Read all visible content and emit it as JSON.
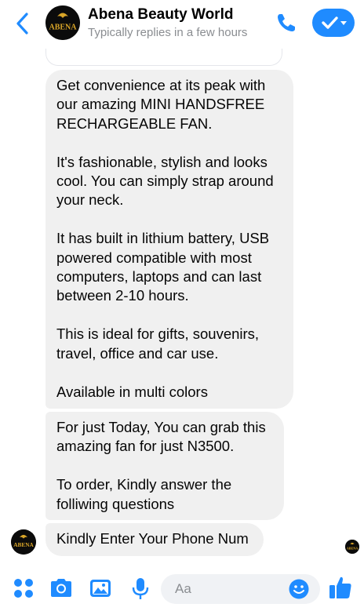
{
  "header": {
    "title": "Abena Beauty World",
    "subtitle": "Typically replies in a few hours",
    "avatar_text": "ABENA"
  },
  "messages": [
    {
      "sender": "page",
      "text": "Get convenience at its peak with\nour amazing MINI HANDSFREE\nRECHARGEABLE FAN.\n\nIt's fashionable, stylish and looks\ncool. You can simply strap around\nyour neck.\n\nIt has built in lithium battery, USB\npowered compatible with most\ncomputers, laptops and can last\nbetween 2-10 hours.\n\nThis is ideal for gifts, souvenirs,\ntravel, office and car use.\n\nAvailable in multi colors"
    },
    {
      "sender": "page",
      "text": "For just Today, You can grab this\namazing fan for just N3500.\n\nTo order, Kindly answer the\nfolliwing questions"
    },
    {
      "sender": "page",
      "text": "Kindly Enter Your Phone Num"
    }
  ],
  "composer": {
    "placeholder": "Aa"
  },
  "colors": {
    "accent": "#1f8bff",
    "bubble": "#f0f0f0",
    "logo_gold": "#d9a528"
  },
  "icons": [
    "back-chevron-icon",
    "phone-icon",
    "checkmark-icon",
    "four-dots-icon",
    "camera-icon",
    "photo-icon",
    "microphone-icon",
    "emoji-icon",
    "thumbs-up-icon"
  ]
}
